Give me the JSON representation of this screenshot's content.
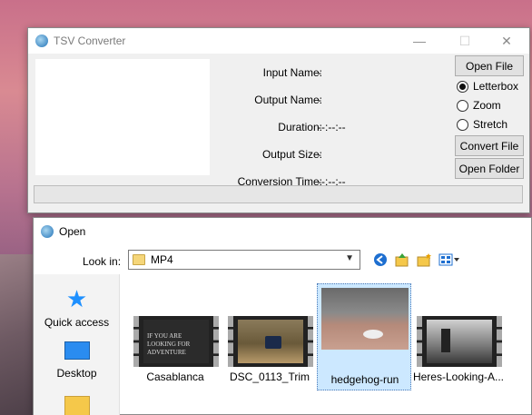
{
  "tsv_window": {
    "title": "TSV Converter",
    "controls": {
      "minimize": "—",
      "maximize": "☐",
      "close": "✕"
    },
    "fields": [
      {
        "label": "Input Name:",
        "value": "-"
      },
      {
        "label": "Output Name:",
        "value": "-"
      },
      {
        "label": "Duration:",
        "value": "--:--:--"
      },
      {
        "label": "Output Size:",
        "value": "-"
      },
      {
        "label": "Conversion Time:",
        "value": "--:--:--"
      }
    ],
    "buttons": {
      "open_file": "Open File",
      "convert_file": "Convert File",
      "open_folder": "Open Folder"
    },
    "modes": [
      {
        "label": "Letterbox",
        "selected": true
      },
      {
        "label": "Zoom",
        "selected": false
      },
      {
        "label": "Stretch",
        "selected": false
      }
    ],
    "progress": 0
  },
  "open_dialog": {
    "title": "Open",
    "look_in_label": "Look in:",
    "look_in_value": "MP4",
    "places": [
      {
        "label": "Quick access",
        "icon": "quick-access-star-icon"
      },
      {
        "label": "Desktop",
        "icon": "desktop-icon"
      },
      {
        "label": "",
        "icon": "documents-folder-icon"
      }
    ],
    "files": [
      {
        "name": "Casablanca",
        "selected": false
      },
      {
        "name": "DSC_0113_Trim",
        "selected": false
      },
      {
        "name": "hedgehog-run",
        "selected": true
      },
      {
        "name": "Heres-Looking-A...",
        "selected": false
      }
    ],
    "thumb_overlay_text": "IF YOU ARE LOOKING FOR ADVENTURE"
  }
}
